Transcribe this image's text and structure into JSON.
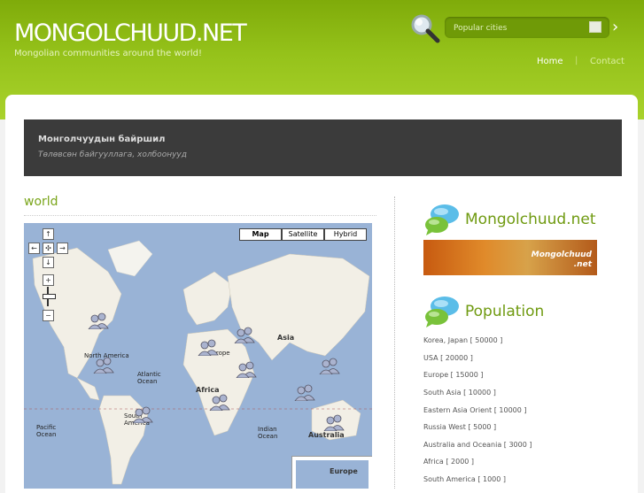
{
  "header": {
    "logo": "MONGOLCHUUD.NET",
    "tagline": "Mongolian communities around the world!",
    "search_placeholder": "Popular cities",
    "go_arrow": "›",
    "nav": {
      "home": "Home",
      "separator": "|",
      "contact": "Contact"
    }
  },
  "banner": {
    "title": "Монголчуудын байршил",
    "subtitle": "Төлөвсөн байгууллага, холбоонууд"
  },
  "main": {
    "title": "world",
    "map": {
      "types": [
        "Map",
        "Satellite",
        "Hybrid"
      ],
      "selected_type": "Map",
      "labels": {
        "north_america": "North America",
        "atlantic": "Atlantic Ocean",
        "africa": "Africa",
        "asia": "Asia",
        "europe": "Europe",
        "south_america": "South America",
        "pacific": "Pacific Ocean",
        "indian": "Indian Ocean",
        "australia": "Australia",
        "inset_europe": "Europe"
      }
    }
  },
  "sidebar": {
    "site_heading": "Mongolchuud.net",
    "promo_text": "Mongolchuud\n.net",
    "population_heading": "Population",
    "population": [
      "Korea, Japan [ 50000 ]",
      "USA [ 20000 ]",
      "Europe [ 15000 ]",
      "South Asia [ 10000 ]",
      "Eastern Asia Orient [ 10000 ]",
      "Russia West [ 5000 ]",
      "Australia and Oceania [ 3000 ]",
      "Africa [ 2000 ]",
      "South America [ 1000 ]"
    ]
  },
  "colors": {
    "accent_green": "#95c21a",
    "banner_dark": "#3b3b3b",
    "heading_green": "#6f9a10"
  },
  "icons": [
    "search-icon",
    "close-icon",
    "chevron-right-icon",
    "chat-bubble-icon",
    "map-marker-icon"
  ]
}
